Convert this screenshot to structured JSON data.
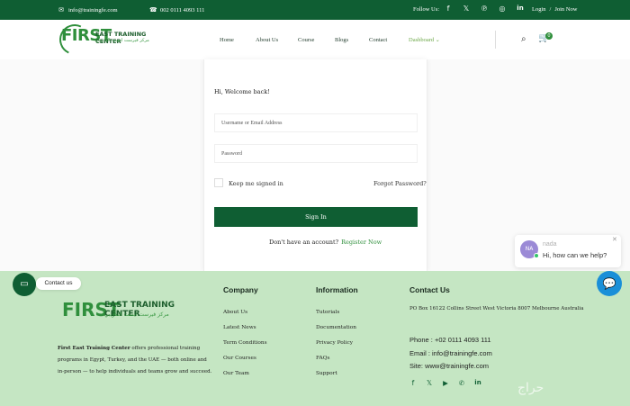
{
  "topbar": {
    "email": "info@trainingfe.com",
    "phone": "002 0111 4093 111",
    "follow_label": "Follow Us:",
    "social_icons": [
      "facebook-icon",
      "x-icon",
      "pinterest-icon",
      "instagram-icon",
      "linkedin-icon"
    ],
    "login": "Login",
    "divider": "/",
    "join": "Join Now"
  },
  "header": {
    "logo_text": "FIRST",
    "logo_sub": "EAST TRAINING CENTER",
    "logo_arabic": "مركز فيرست ايست التدريبي",
    "nav": [
      "Home",
      "About Us",
      "Course",
      "Blogs",
      "Contact",
      "Dashboard"
    ],
    "cart_count": "0"
  },
  "login": {
    "welcome": "Hi, Welcome back!",
    "username_placeholder": "Username or Email Address",
    "password_placeholder": "Password",
    "keep_signed_in": "Keep me signed in",
    "forgot": "Forgot Password?",
    "signin": "Sign In",
    "no_account": "Don't have an account?",
    "register": "Register Now"
  },
  "chat": {
    "avatar": "NA",
    "name": "nada",
    "message": "Hi, how can we help?"
  },
  "contact_widget": {
    "label": "Contact us"
  },
  "footer": {
    "logo_text": "FIRST",
    "logo_sub": "EAST TRAINING CENTER",
    "logo_arabic": "مركز فيرست ايست التدريبي",
    "desc_bold": "First East Training Center",
    "desc_rest": " offers professional training programs in Egypt, Turkey, and the UAE — both online and in-person — to help individuals and teams grow and succeed.",
    "company": {
      "title": "Company",
      "links": [
        "About Us",
        "Latest News",
        "Term Conditions",
        "Our Courses",
        "Our Team"
      ]
    },
    "information": {
      "title": "Information",
      "links": [
        "Tutorials",
        "Documentation",
        "Privacy Policy",
        "FAQs",
        "Support"
      ]
    },
    "contact": {
      "title": "Contact Us",
      "address": "PO Box 16122 Collins Street West Victoria 8007 Melbourne Australia",
      "phone": "Phone : +02 0111 4093 111",
      "email": "Email : info@trainingfe.com",
      "site": "Site: www@trainingfe.com"
    },
    "social_icons": [
      "facebook-icon",
      "x-icon",
      "youtube-icon",
      "whatsapp-icon",
      "linkedin-icon"
    ]
  },
  "watermark": "حراج"
}
